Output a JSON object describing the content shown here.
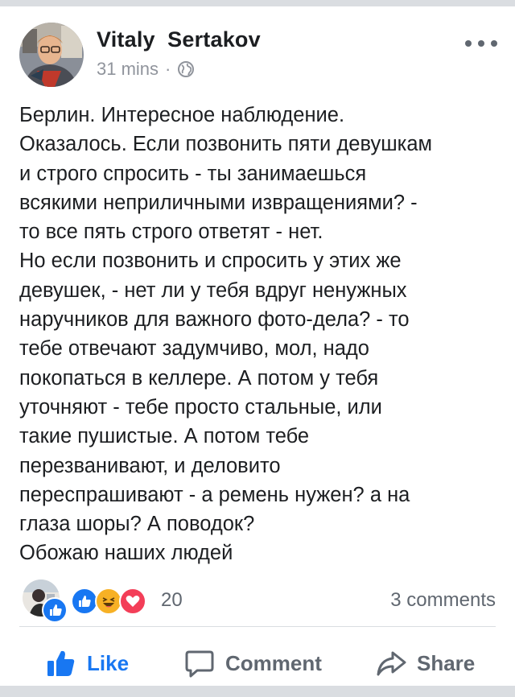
{
  "post": {
    "author": "Vitaly  Sertakov",
    "time": "31 mins",
    "separator": "·",
    "privacy_icon": "globe-icon",
    "more_icon": "more-horizontal-icon",
    "text_lines": [
      "Берлин. Интересное наблюдение.",
      "Оказалось. Если позвонить пяти девушкам",
      "и строго спросить - ты занимаешься",
      "всякими неприличными извращениями? -",
      "то все пять строго ответят - нет.",
      "Но если позвонить и спросить у этих же",
      "девушек, - нет ли у тебя вдруг ненужных",
      "наручников для важного фото-дела? - то",
      "тебе отвечают задумчиво, мол, надо",
      "покопаться в келлере. А потом у тебя",
      "уточняют - тебе просто стальные, или",
      "такие пушистые. А потом тебе",
      "перезванивают, и деловито",
      "переспрашивают - а ремень нужен? а на",
      "глаза шоры? А поводок?",
      "Обожаю наших людей"
    ]
  },
  "reactions": {
    "icons": [
      "like-reaction-icon",
      "haha-reaction-icon",
      "love-reaction-icon"
    ],
    "count": "20",
    "comments": "3 comments"
  },
  "actions": {
    "like": "Like",
    "comment": "Comment",
    "share": "Share"
  },
  "colors": {
    "accent": "#1877f2",
    "text": "#1c1e21",
    "secondary": "#606770",
    "love": "#f33e58",
    "haha": "#f7b125"
  }
}
